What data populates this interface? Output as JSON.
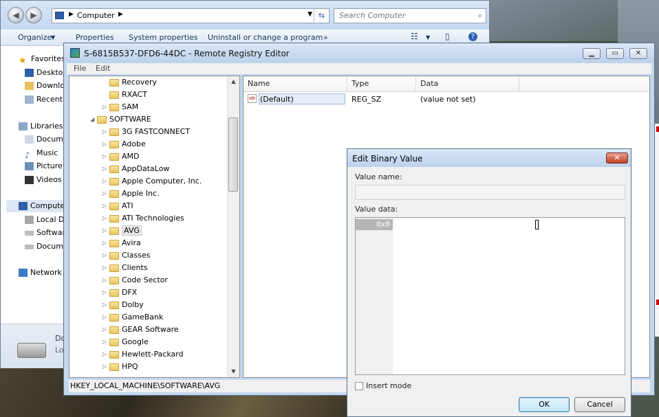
{
  "explorer": {
    "address": "Computer",
    "search_placeholder": "Search Computer",
    "toolbar": [
      "Organize",
      "Properties",
      "System properties",
      "Uninstall or change a program",
      "»"
    ],
    "nav": {
      "favorites": "Favorites",
      "desktop": "Desktop",
      "downloads": "Downlo",
      "recent": "Recent",
      "libraries": "Libraries",
      "documents": "Docum",
      "music": "Music",
      "pictures": "Picture",
      "videos": "Videos",
      "computer": "Compute",
      "local_disk": "Local D",
      "software": "Softwar",
      "documents2": "Docum",
      "network": "Network"
    },
    "details": {
      "line1": "Do",
      "line2": "Lo"
    }
  },
  "regedit": {
    "title": "S-6815B537-DFD6-44DC - Remote Registry Editor",
    "menu": [
      "File",
      "Edit"
    ],
    "tree": [
      {
        "label": "Recovery",
        "expander": ""
      },
      {
        "label": "RXACT",
        "expander": ""
      },
      {
        "label": "SAM",
        "expander": "▷"
      },
      {
        "label": "SOFTWARE",
        "expander": "◢"
      },
      {
        "label": "3G FASTCONNECT",
        "expander": "▷"
      },
      {
        "label": "Adobe",
        "expander": "▷"
      },
      {
        "label": "AMD",
        "expander": "▷"
      },
      {
        "label": "AppDataLow",
        "expander": "▷"
      },
      {
        "label": "Apple Computer, Inc.",
        "expander": "▷"
      },
      {
        "label": "Apple Inc.",
        "expander": "▷"
      },
      {
        "label": "ATI",
        "expander": "▷"
      },
      {
        "label": "ATI Technologies",
        "expander": "▷"
      },
      {
        "label": "AVG",
        "expander": "▷"
      },
      {
        "label": "Avira",
        "expander": "▷"
      },
      {
        "label": "Classes",
        "expander": "▷"
      },
      {
        "label": "Clients",
        "expander": "▷"
      },
      {
        "label": "Code Sector",
        "expander": "▷"
      },
      {
        "label": "DFX",
        "expander": "▷"
      },
      {
        "label": "Dolby",
        "expander": "▷"
      },
      {
        "label": "GameBank",
        "expander": "▷"
      },
      {
        "label": "GEAR Software",
        "expander": "▷"
      },
      {
        "label": "Google",
        "expander": "▷"
      },
      {
        "label": "Hewlett-Packard",
        "expander": "▷"
      },
      {
        "label": "HPQ",
        "expander": "▷"
      }
    ],
    "columns": [
      "Name",
      "Type",
      "Data"
    ],
    "rows": [
      {
        "name": "(Default)",
        "type": "REG_SZ",
        "data": "(value not set)"
      }
    ],
    "status": "HKEY_LOCAL_MACHINE\\SOFTWARE\\AVG"
  },
  "dialog": {
    "title": "Edit Binary Value",
    "value_name_label": "Value name:",
    "value_name": "",
    "value_data_label": "Value data:",
    "offset": "0x0",
    "insert_mode": "Insert mode",
    "ok": "OK",
    "cancel": "Cancel"
  }
}
